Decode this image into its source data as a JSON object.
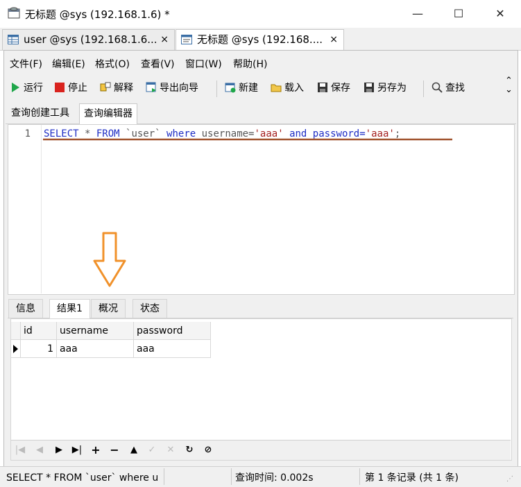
{
  "window": {
    "title": "无标题 @sys (192.168.1.6) *"
  },
  "doc_tabs": [
    {
      "label": "user @sys (192.168.1.6...",
      "close": "×"
    },
    {
      "label": "无标题 @sys (192.168....",
      "close": "×"
    }
  ],
  "menu": [
    "文件(F)",
    "编辑(E)",
    "格式(O)",
    "查看(V)",
    "窗口(W)",
    "帮助(H)"
  ],
  "toolbar": {
    "run": "运行",
    "stop": "停止",
    "explain": "解释",
    "export": "导出向导",
    "new": "新建",
    "load": "载入",
    "save": "保存",
    "save_as": "另存为",
    "find": "查找"
  },
  "sub_tabs": [
    "查询创建工具",
    "查询编辑器"
  ],
  "editor": {
    "line_number": "1",
    "tokens": {
      "select": "SELECT",
      "star": " * ",
      "from": "FROM",
      "table": " `user` ",
      "where": "where",
      "username": " username=",
      "val1": "'aaa'",
      "and": " and ",
      "password": "password=",
      "val2": "'aaa'",
      "semi": ";"
    }
  },
  "result_tabs": [
    "信息",
    "结果1",
    "概况",
    "状态"
  ],
  "grid": {
    "columns": [
      "id",
      "username",
      "password"
    ],
    "rows": [
      [
        "1",
        "aaa",
        "aaa"
      ]
    ]
  },
  "nav_buttons": [
    "first",
    "prev",
    "next",
    "last",
    "add",
    "delete",
    "apply",
    "edit-check",
    "cancel",
    "refresh",
    "stop"
  ],
  "status": {
    "query": "SELECT * FROM `user` where u",
    "time": "查询时间: 0.002s",
    "records": "第 1 条记录 (共 1 条)"
  },
  "colors": {
    "keyword": "#1d2cc4",
    "string": "#a4201f",
    "underline": "#a0522d",
    "arrow": "#f0912a"
  }
}
